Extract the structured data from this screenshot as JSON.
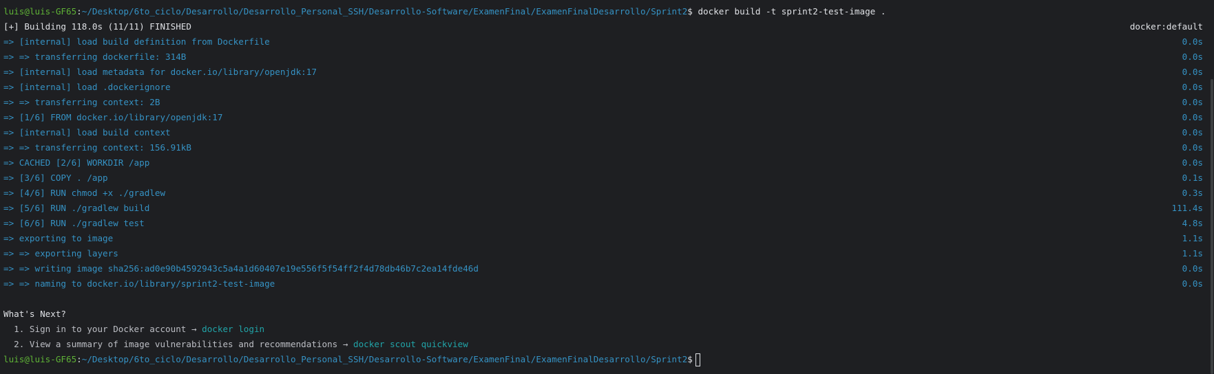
{
  "prompt": {
    "user_host": "luis@luis-GF65",
    "path": "~/Desktop/6to_ciclo/Desarrollo/Desarrollo_Personal_SSH/Desarrollo-Software/ExamenFinal/ExamenFinalDesarrollo/Sprint2",
    "symbol": "$",
    "command": " docker build -t sprint2-test-image ."
  },
  "build_header": {
    "text": "[+] Building 118.0s (11/11) FINISHED",
    "context": "docker:default"
  },
  "steps": [
    {
      "text": "=> [internal] load build definition from Dockerfile",
      "time": "0.0s"
    },
    {
      "text": "=> => transferring dockerfile: 314B",
      "time": "0.0s"
    },
    {
      "text": "=> [internal] load metadata for docker.io/library/openjdk:17",
      "time": "0.0s"
    },
    {
      "text": "=> [internal] load .dockerignore",
      "time": "0.0s"
    },
    {
      "text": "=> => transferring context: 2B",
      "time": "0.0s"
    },
    {
      "text": "=> [1/6] FROM docker.io/library/openjdk:17",
      "time": "0.0s"
    },
    {
      "text": "=> [internal] load build context",
      "time": "0.0s"
    },
    {
      "text": "=> => transferring context: 156.91kB",
      "time": "0.0s"
    },
    {
      "text": "=> CACHED [2/6] WORKDIR /app",
      "time": "0.0s"
    },
    {
      "text": "=> [3/6] COPY . /app",
      "time": "0.1s"
    },
    {
      "text": "=> [4/6] RUN chmod +x ./gradlew",
      "time": "0.3s"
    },
    {
      "text": "=> [5/6] RUN ./gradlew build",
      "time": "111.4s"
    },
    {
      "text": "=> [6/6] RUN ./gradlew test",
      "time": "4.8s"
    },
    {
      "text": "=> exporting to image",
      "time": "1.1s"
    },
    {
      "text": "=> => exporting layers",
      "time": "1.1s"
    },
    {
      "text": "=> => writing image sha256:ad0e90b4592943c5a4a1d60407e19e556f5f54ff2f4d78db46b7c2ea14fde46d",
      "time": "0.0s"
    },
    {
      "text": "=> => naming to docker.io/library/sprint2-test-image",
      "time": "0.0s"
    }
  ],
  "whats_next": {
    "title": "What's Next?",
    "items": [
      {
        "text": "  1. Sign in to your Docker account → ",
        "cmd": "docker login"
      },
      {
        "text": "  2. View a summary of image vulnerabilities and recommendations → ",
        "cmd": "docker scout quickview"
      }
    ]
  }
}
